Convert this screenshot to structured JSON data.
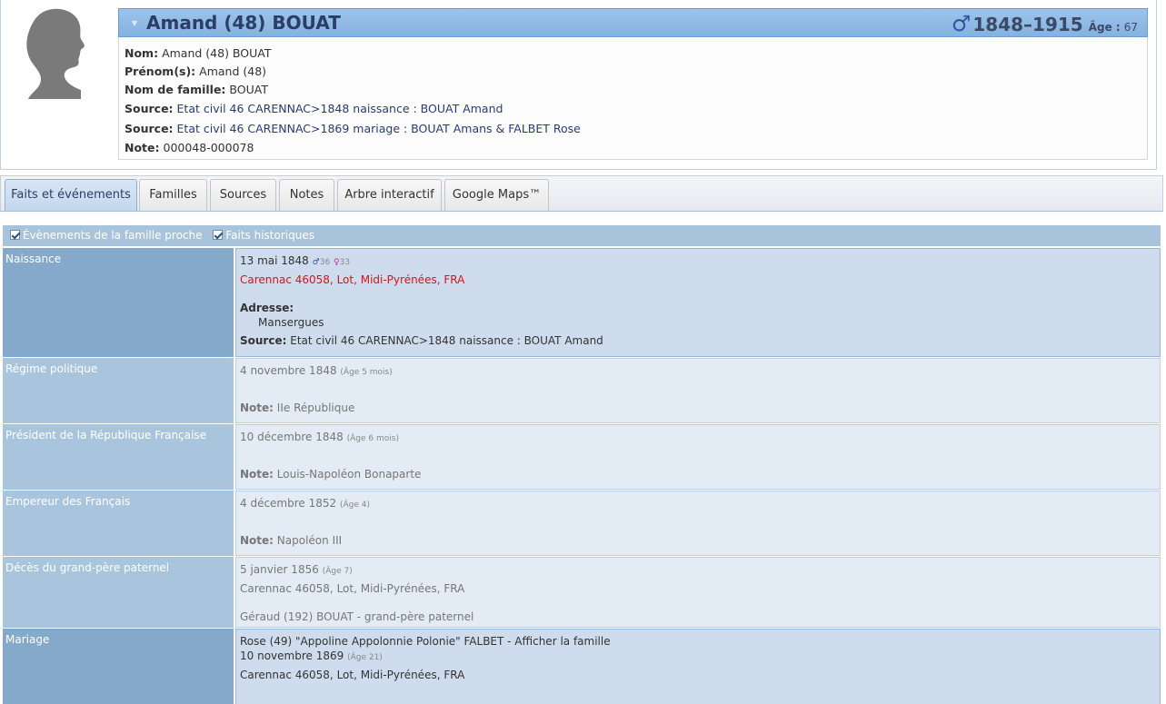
{
  "person": {
    "name": "Amand (48) BOUAT",
    "sex_symbol": "♂",
    "lifespan": "1848–1915",
    "age_label": "Âge :",
    "age_value": "67",
    "facts": {
      "nom_label": "Nom:",
      "nom": "Amand (48) BOUAT",
      "prenom_label": "Prénom(s):",
      "prenom": "Amand (48)",
      "famille_label": "Nom de famille:",
      "famille": "BOUAT",
      "source_label": "Source:",
      "source1": "Etat civil 46 CARENNAC>1848 naissance : BOUAT Amand",
      "source2": "Etat civil 46 CARENNAC>1869 mariage : BOUAT Amans & FALBET Rose",
      "note_label": "Note:",
      "note": "000048-000078"
    }
  },
  "tabs": [
    "Faits et événements",
    "Familles",
    "Sources",
    "Notes",
    "Arbre interactif",
    "Google Maps™"
  ],
  "options": {
    "family": "Évènements de la famille proche",
    "historic": "Faits historiques"
  },
  "events": {
    "naissance": {
      "label": "Naissance",
      "date": "13 mai 1848",
      "father_sym": "♂",
      "father_age": "36",
      "mother_sym": "♀",
      "mother_age": "33",
      "place": "Carennac 46058, Lot, Midi-Pyrénées, FRA",
      "addr_label": "Adresse:",
      "addr": "Mansergues",
      "source_label": "Source:",
      "source": "Etat civil 46 CARENNAC>1848 naissance : BOUAT Amand"
    },
    "regime": {
      "label": "Régime politique",
      "date": "4 novembre 1848",
      "age": "(Âge 5 mois)",
      "note_label": "Note:",
      "note": "IIe République"
    },
    "president": {
      "label": "Président de la République Française",
      "date": "10 décembre 1848",
      "age": "(Âge 6 mois)",
      "note_label": "Note:",
      "note": "Louis-Napoléon Bonaparte"
    },
    "empereur": {
      "label": "Empereur des Français",
      "date": "4 décembre 1852",
      "age": "(Âge 4)",
      "note_label": "Note:",
      "note": "Napoléon III"
    },
    "deces": {
      "label": "Décès du grand-père paternel",
      "date": "5 janvier 1856",
      "age": "(Âge 7)",
      "place": "Carennac 46058, Lot, Midi-Pyrénées, FRA",
      "person": "Géraud (192) BOUAT - grand-père paternel"
    },
    "mariage": {
      "label": "Mariage",
      "spouse": "Rose (49) \"Appoline Appolonnie Polonie\" FALBET - Afficher la famille",
      "date": "10 novembre 1869",
      "age": "(Âge 21)",
      "place": "Carennac 46058, Lot, Midi-Pyrénées, FRA"
    }
  }
}
